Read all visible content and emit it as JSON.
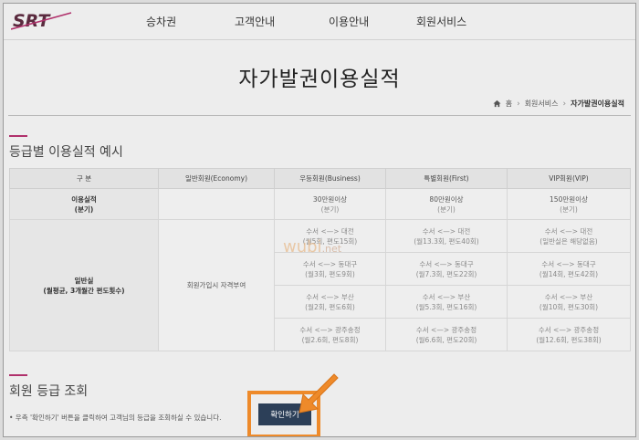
{
  "header": {
    "logo": "SRT",
    "nav": [
      "승차권",
      "고객안내",
      "이용안내",
      "회원서비스"
    ]
  },
  "page": {
    "title": "자가발권이용실적"
  },
  "breadcrumb": {
    "home": "홈",
    "items": [
      "회원서비스",
      "자가발권이용실적"
    ],
    "home_icon": "home-icon"
  },
  "section1": {
    "title": "등급별 이용실적 예시"
  },
  "table": {
    "headers": [
      "구 분",
      "일반회원(Economy)",
      "우등회원(Business)",
      "특별회원(First)",
      "VIP회원(VIP)"
    ],
    "performance": {
      "label": [
        "이용실적",
        "(분기)"
      ],
      "economy": "",
      "business": [
        "30만원이상",
        "(분기)"
      ],
      "first": [
        "80만원이상",
        "(분기)"
      ],
      "vip": [
        "150만원이상",
        "(분기)"
      ]
    },
    "general": {
      "label": [
        "일반실",
        "(월평균, 3개월간 편도횟수)"
      ],
      "economy": "회원가입시 자격부여",
      "rows": [
        {
          "business": [
            "수서 <—> 대전",
            "(월5회, 편도15회)"
          ],
          "first": [
            "수서 <—> 대전",
            "(월13.3회, 편도40회)"
          ],
          "vip": [
            "수서 <—> 대전",
            "(일반실은 해당없음)"
          ]
        },
        {
          "business": [
            "수서 <—> 동대구",
            "(월3회, 편도9회)"
          ],
          "first": [
            "수서 <—> 동대구",
            "(월7.3회, 편도22회)"
          ],
          "vip": [
            "수서 <—> 동대구",
            "(월14회, 편도42회)"
          ]
        },
        {
          "business": [
            "수서 <—> 부산",
            "(월2회, 편도6회)"
          ],
          "first": [
            "수서 <—> 부산",
            "(월5.3회, 편도16회)"
          ],
          "vip": [
            "수서 <—> 부산",
            "(월10회, 편도30회)"
          ]
        },
        {
          "business": [
            "수서 <—> 광주송정",
            "(월2.6회, 편도8회)"
          ],
          "first": [
            "수서 <—> 광주송정",
            "(월6.6회, 편도20회)"
          ],
          "vip": [
            "수서 <—> 광주송정",
            "(월12.6회, 편도38회)"
          ]
        }
      ]
    }
  },
  "section2": {
    "title": "회원 등급 조회"
  },
  "note": "• 우측 '확인하기' 버튼을 클릭하여 고객님의 등급을 조회하실 수 있습니다.",
  "confirm_button": "확인하기",
  "watermark": {
    "main": "wubi",
    "suffix": ".net"
  },
  "colors": {
    "accent": "#b0306b",
    "button": "#2c3f58",
    "highlight": "#ee8a2a"
  }
}
